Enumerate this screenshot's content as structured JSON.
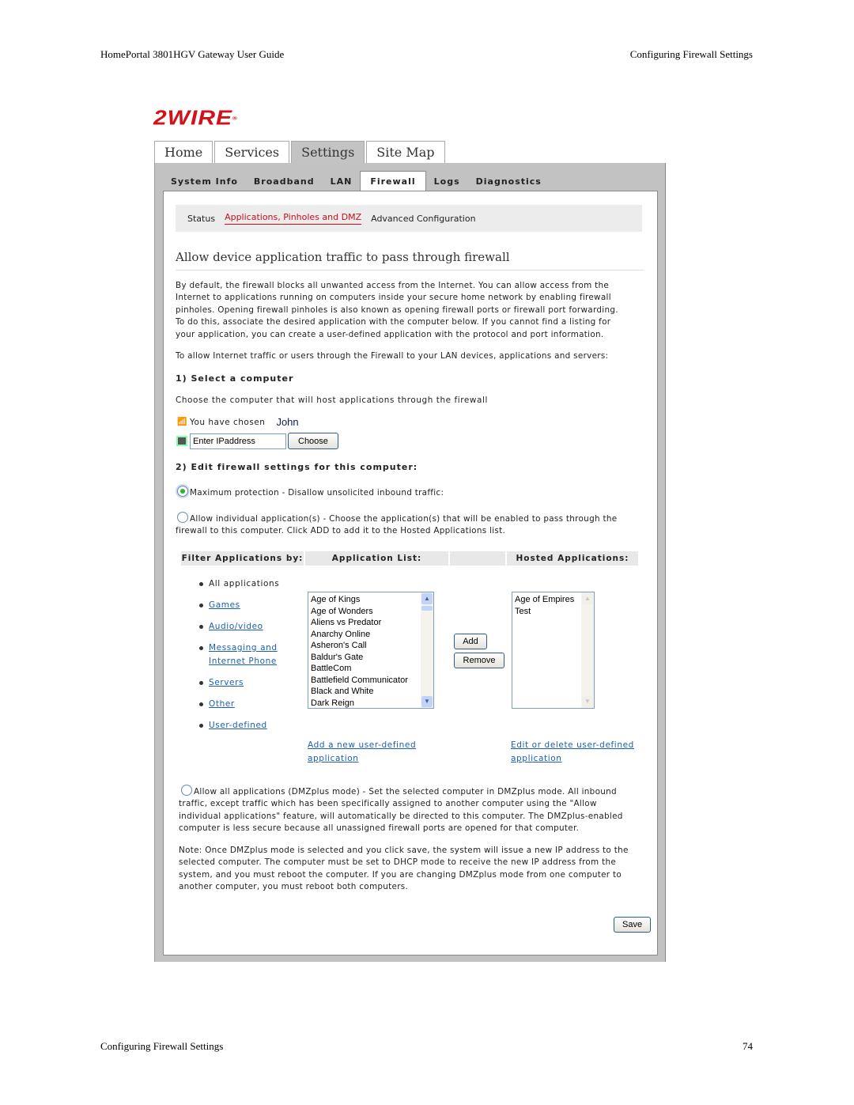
{
  "doc": {
    "header_left": "HomePortal 3801HGV Gateway User Guide",
    "header_right": "Configuring Firewall Settings",
    "footer_left": "Configuring Firewall Settings",
    "footer_right": "74"
  },
  "brand": {
    "logo_text": "2WIRE",
    "registered": "®",
    "color": "#d0121b"
  },
  "top_tabs": [
    {
      "label": "Home",
      "active": false
    },
    {
      "label": "Services",
      "active": false
    },
    {
      "label": "Settings",
      "active": true
    },
    {
      "label": "Site Map",
      "active": false
    }
  ],
  "sub_tabs": [
    {
      "label": "System Info"
    },
    {
      "label": "Broadband"
    },
    {
      "label": "LAN"
    },
    {
      "label": "Firewall",
      "active": true
    },
    {
      "label": "Logs"
    },
    {
      "label": "Diagnostics"
    }
  ],
  "subnav": {
    "status": "Status",
    "active": "Applications, Pinholes and DMZ",
    "advanced": "Advanced Configuration"
  },
  "page_title": "Allow device application traffic to pass through firewall",
  "intro": [
    "By default, the firewall blocks all unwanted access from the Internet. You can allow access from the",
    "Internet to applications running on computers inside your secure home network by enabling firewall",
    "pinholes. Opening firewall pinholes is also known as opening firewall ports or firewall port forwarding.",
    "To do this, associate the desired application with the computer below. If you cannot find a listing for",
    "your application, you can create a user-defined application with the protocol and port information."
  ],
  "intro2": "To allow Internet traffic or users through the Firewall to your LAN devices, applications and servers:",
  "step1": {
    "heading": "1) Select a computer",
    "description": "Choose the computer that will host applications through the firewall",
    "chosen_label": "You have chosen",
    "chosen_name": "John",
    "ip_value": "Enter IPaddress",
    "choose_button": "Choose"
  },
  "step2": {
    "heading": "2) Edit firewall settings for this computer:",
    "max_protection": "Maximum protection - Disallow unsolicited inbound traffic:",
    "individual_line1": "Allow individual application(s) - Choose the application(s) that will be enabled to pass through the",
    "individual_line2": "firewall to this computer. Click ADD to add it to the Hosted Applications list.",
    "dmz_lines": [
      "Allow all applications (DMZplus mode) - Set the selected computer in DMZplus mode. All inbound",
      "traffic, except traffic which has been specifically assigned to another computer using the \"Allow",
      "individual applications\" feature, will automatically be directed to this computer. The DMZplus-enabled",
      "computer is less secure because all unassigned firewall ports are opened for that computer."
    ],
    "note_lines": [
      "Note: Once DMZplus mode is selected and you click save, the system will issue a new IP address to the",
      "selected computer. The computer must be set to DHCP mode to receive the new IP address from the",
      "system, and you must reboot the computer. If you are changing DMZplus mode from one computer to",
      "another computer, you must reboot both computers."
    ],
    "selected_option": "max_protection"
  },
  "app_table": {
    "headers": {
      "filter": "Filter Applications by:",
      "list": "Application List:",
      "blank": "",
      "hosted": "Hosted Applications:"
    },
    "filters": {
      "all": "All applications",
      "games": "Games",
      "audio": "Audio/video",
      "messaging1": "Messaging and",
      "messaging2": "Internet Phone",
      "servers": "Servers",
      "other": "Other",
      "user": "User-defined"
    },
    "application_list": [
      "Age of Kings",
      "Age of Wonders",
      "Aliens vs Predator",
      "Anarchy Online",
      "Asheron's Call",
      "Baldur's Gate",
      "BattleCom",
      "Battlefield Communicator",
      "Black and White",
      "Dark Reign"
    ],
    "hosted_list": [
      "Age of Empires",
      "Test"
    ],
    "add_button": "Add",
    "remove_button": "Remove",
    "add_link1": "Add a new user-defined",
    "add_link2": "application",
    "edit_link1": "Edit or delete user-defined",
    "edit_link2": "application"
  },
  "save_button": "Save"
}
